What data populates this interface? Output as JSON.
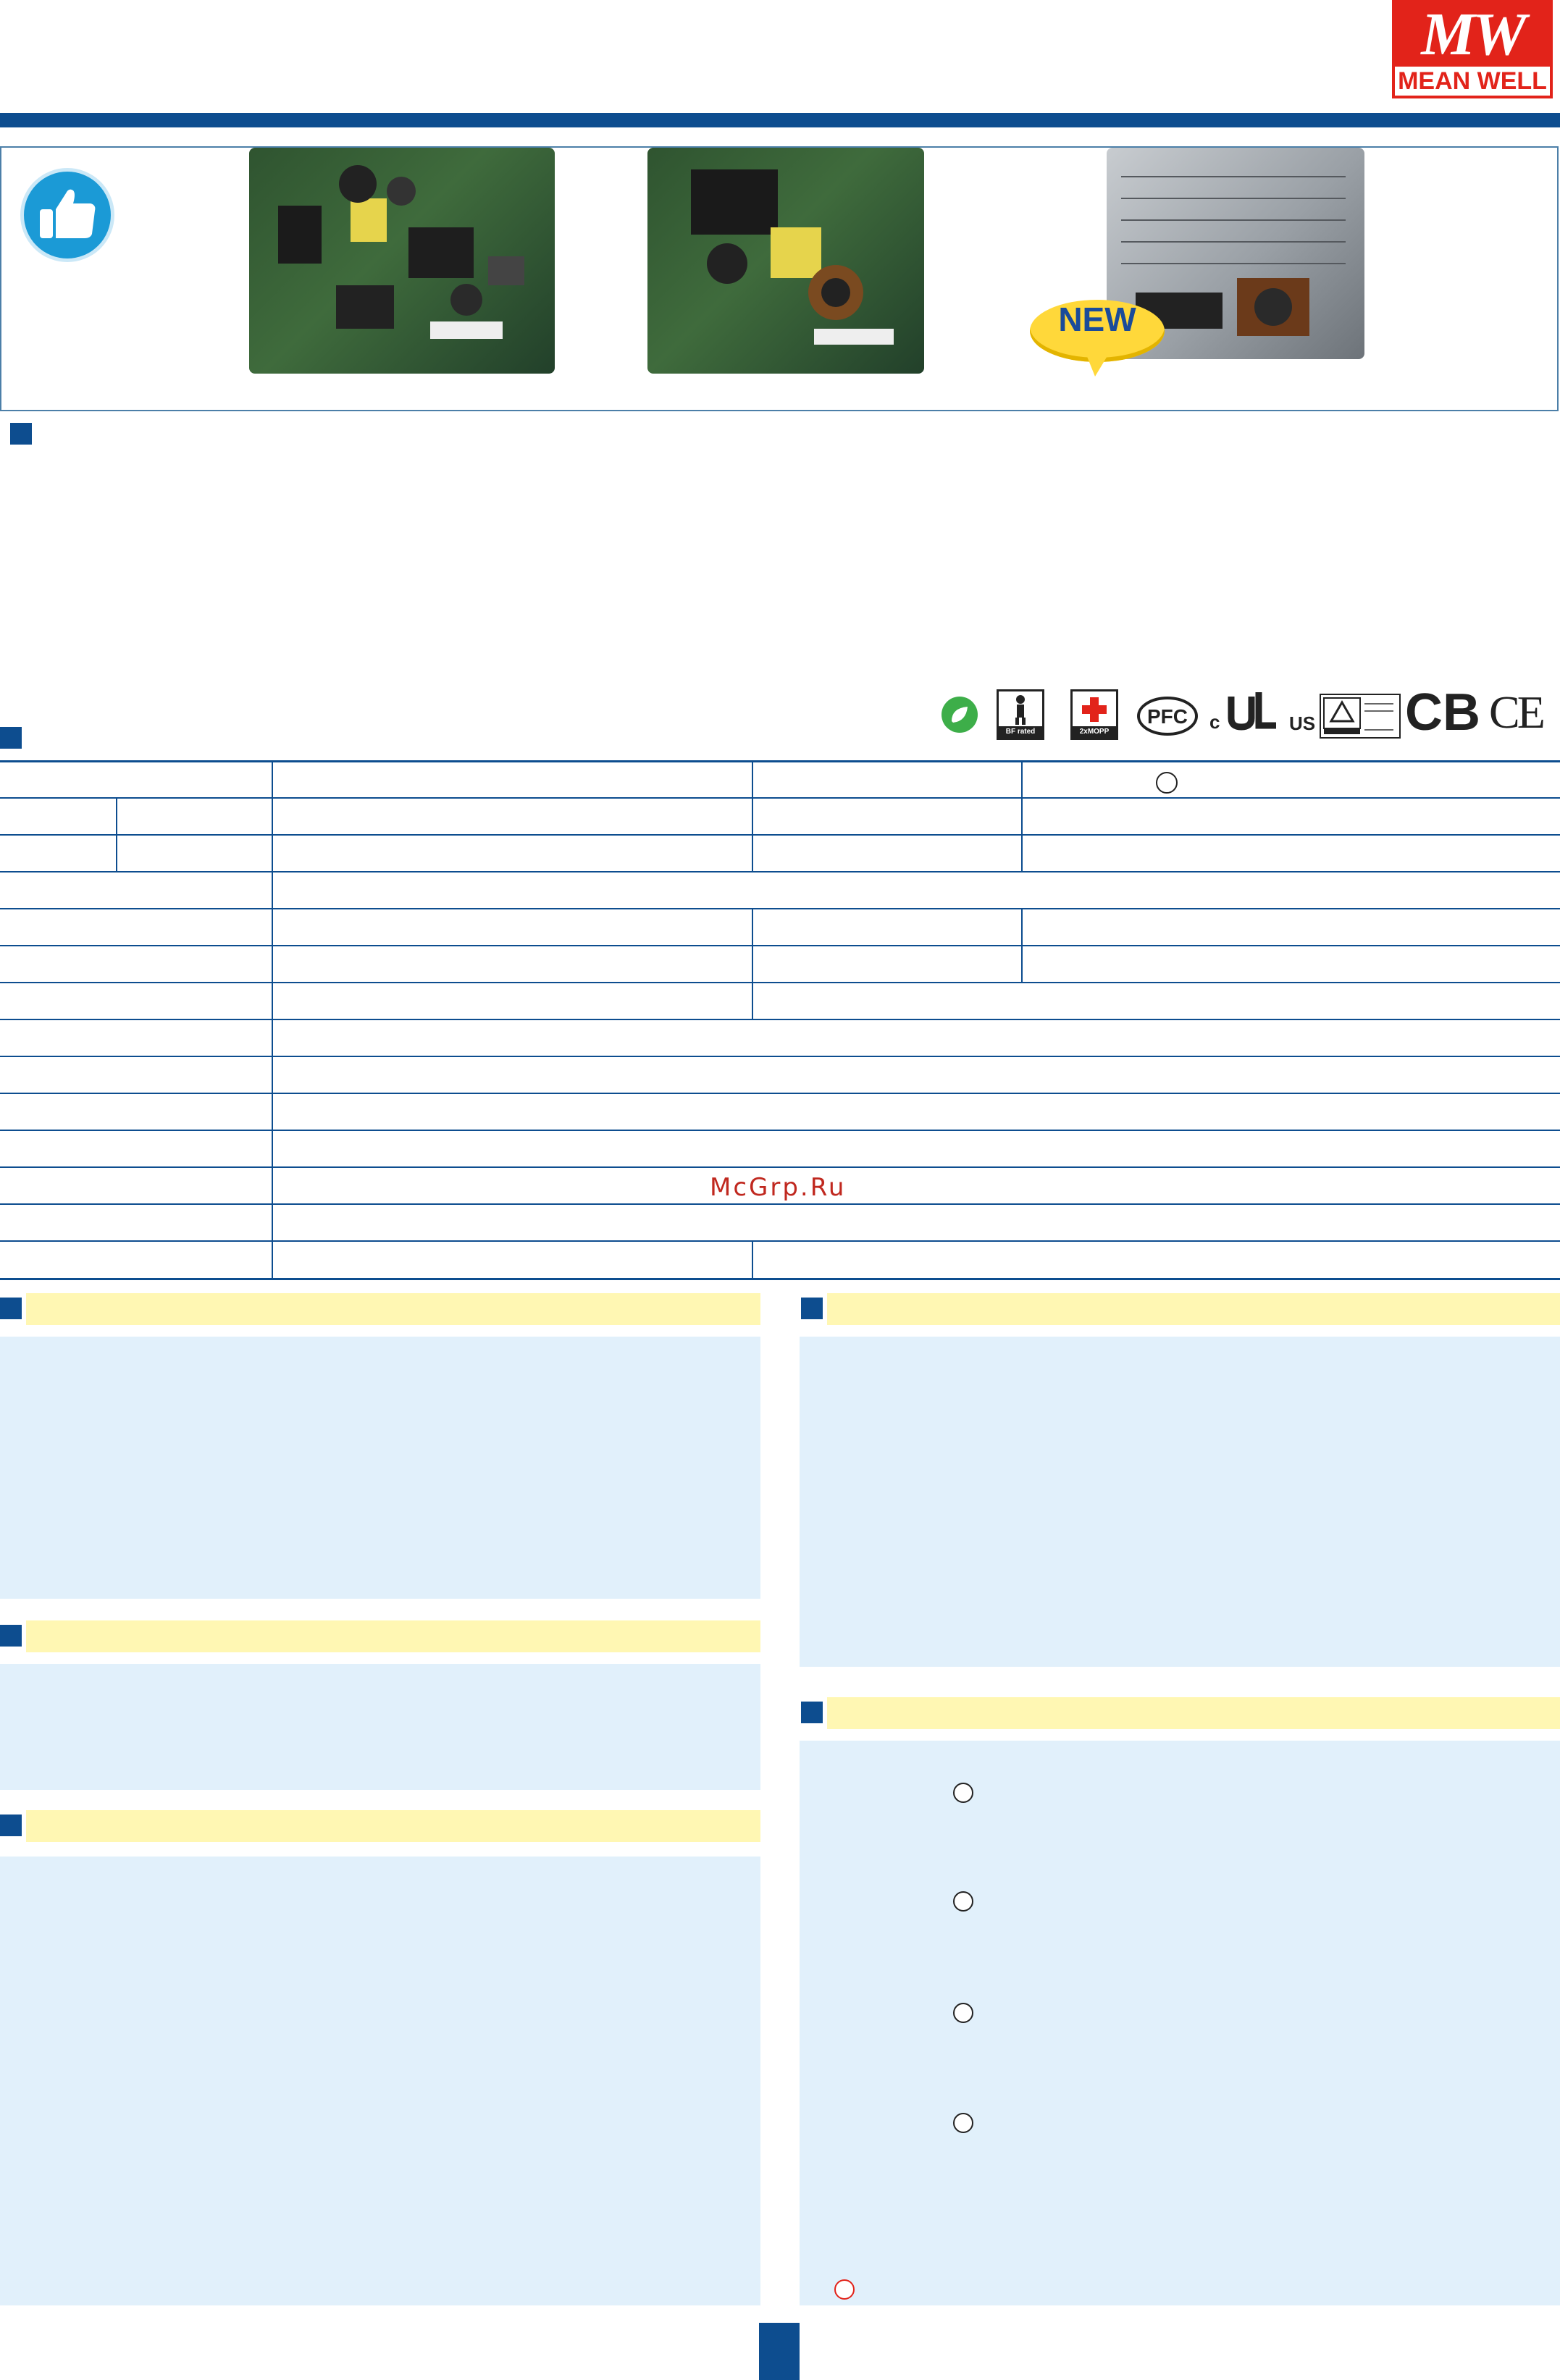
{
  "brand": {
    "logo_mark": "MW",
    "logo_text": "MEAN WELL"
  },
  "badges": {
    "new_label": "NEW"
  },
  "certifications": {
    "bf_rated": "BF rated",
    "mopp": "2xMOPP",
    "cb": "CB",
    "ce": "CE",
    "ul_prefix": "c",
    "ul_suffix": "US"
  },
  "watermark": "McGrp.Ru",
  "colors": {
    "brand_red": "#e2231a",
    "navy": "#0d4d8f",
    "section_yellow": "#fff7b3",
    "section_blue": "#e1f0fb"
  }
}
